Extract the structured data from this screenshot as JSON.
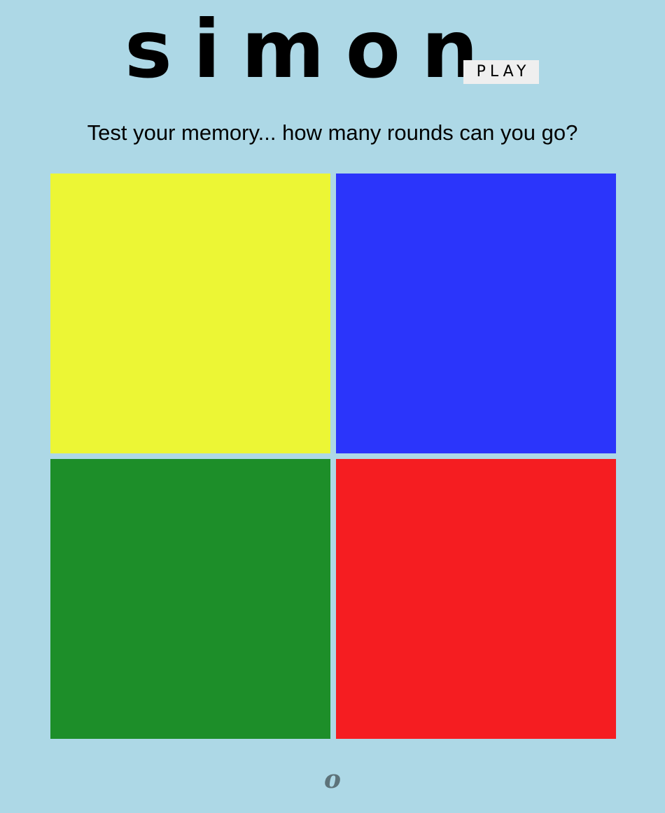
{
  "header": {
    "title": "simon",
    "play_label": "PLAY"
  },
  "subtitle": "Test your memory... how many rounds can you go?",
  "board": {
    "pads": [
      {
        "name": "yellow",
        "color": "#ecf635"
      },
      {
        "name": "blue",
        "color": "#2b35fb"
      },
      {
        "name": "green",
        "color": "#1d8e29"
      },
      {
        "name": "red",
        "color": "#f51d21"
      }
    ]
  },
  "colors": {
    "background": "#add8e6",
    "button": "#efefef",
    "logo": "#5d737a"
  },
  "footer": {
    "logo_icon": "o-logo-icon",
    "logo_glyph": "o"
  }
}
